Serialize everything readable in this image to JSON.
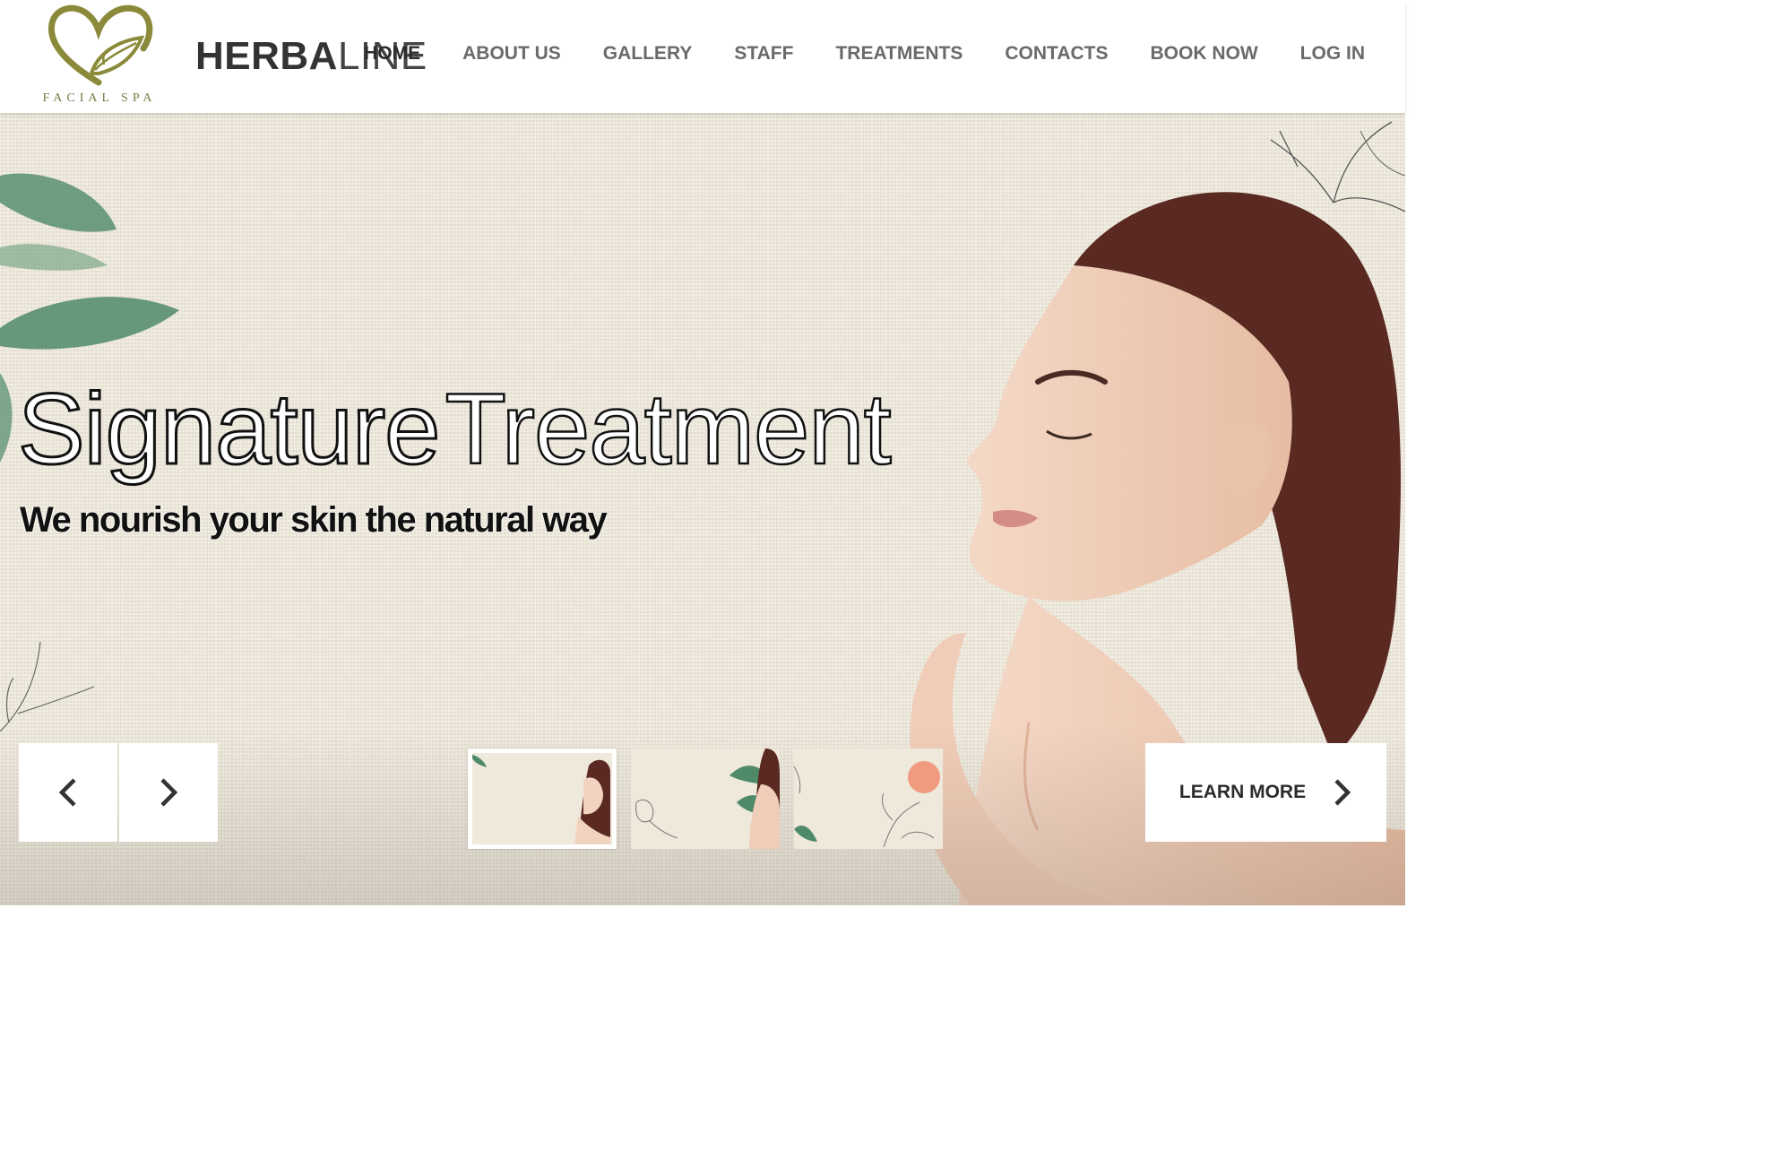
{
  "header": {
    "logo_text": "FACIAL SPA",
    "brand_bold": "HERBA",
    "brand_light": "LINE",
    "nav": [
      {
        "label": "HOME",
        "active": true
      },
      {
        "label": "ABOUT US"
      },
      {
        "label": "GALLERY"
      },
      {
        "label": "STAFF"
      },
      {
        "label": "TREATMENTS"
      },
      {
        "label": "CONTACTS"
      },
      {
        "label": "BOOK NOW"
      },
      {
        "label": "LOG IN"
      }
    ]
  },
  "hero": {
    "title_part1": "Signature",
    "title_part2": "Treatment",
    "subtitle": "We nourish your skin the natural way",
    "learn_more_label": "LEARN MORE",
    "prev_icon": "chevron-left-icon",
    "next_icon": "chevron-right-icon",
    "thumbnail_count": 3,
    "active_thumbnail": 1
  },
  "colors": {
    "brand_olive": "#8a8a3a",
    "nav_active": "#2b2b2b",
    "nav_inactive": "#6a6a6a",
    "hero_bg": "#ede7d8",
    "leaf_green": "#4f8a68"
  }
}
